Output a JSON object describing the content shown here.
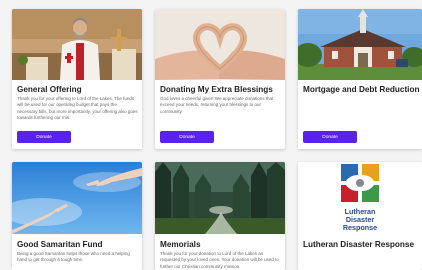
{
  "cards": [
    {
      "title": "General Offering",
      "description": "Thank you for your offering to Lord of the Lakes. The funds will be used for our operating budget that pays the necessary bills, but more importantly, your offering also goes towards furthering our mis",
      "button": "Donate",
      "image": "pastor-at-altar"
    },
    {
      "title": "Donating My Extra Blessings",
      "description": "God loves a cheerful giver! We appreciate donations that exceed your needs, returning your blessings to our community.",
      "button": "Donate",
      "image": "hands-heart"
    },
    {
      "title": "Mortgage and Debt Reduction",
      "description": "",
      "button": "Donate",
      "image": "church-building"
    },
    {
      "title": "Good Samaritan Fund",
      "description": "Being a good Samaritan helps those who need a helping hand to get through a tough time.",
      "image": "reaching-hands-sky"
    },
    {
      "title": "Memorials",
      "description": "Thank you for your donation to Lord of the Lakes as requested by your loved ones. Your donation will be used to further our Christian community mission.",
      "image": "forest-path"
    },
    {
      "title": "Lutheran Disaster Response",
      "description": "",
      "image": "ldr-logo",
      "logo_text": [
        "Lutheran",
        "Disaster",
        "Response"
      ]
    }
  ],
  "colors": {
    "accent": "#5a23e8",
    "title": "#222222",
    "text": "#6a6a6a"
  }
}
